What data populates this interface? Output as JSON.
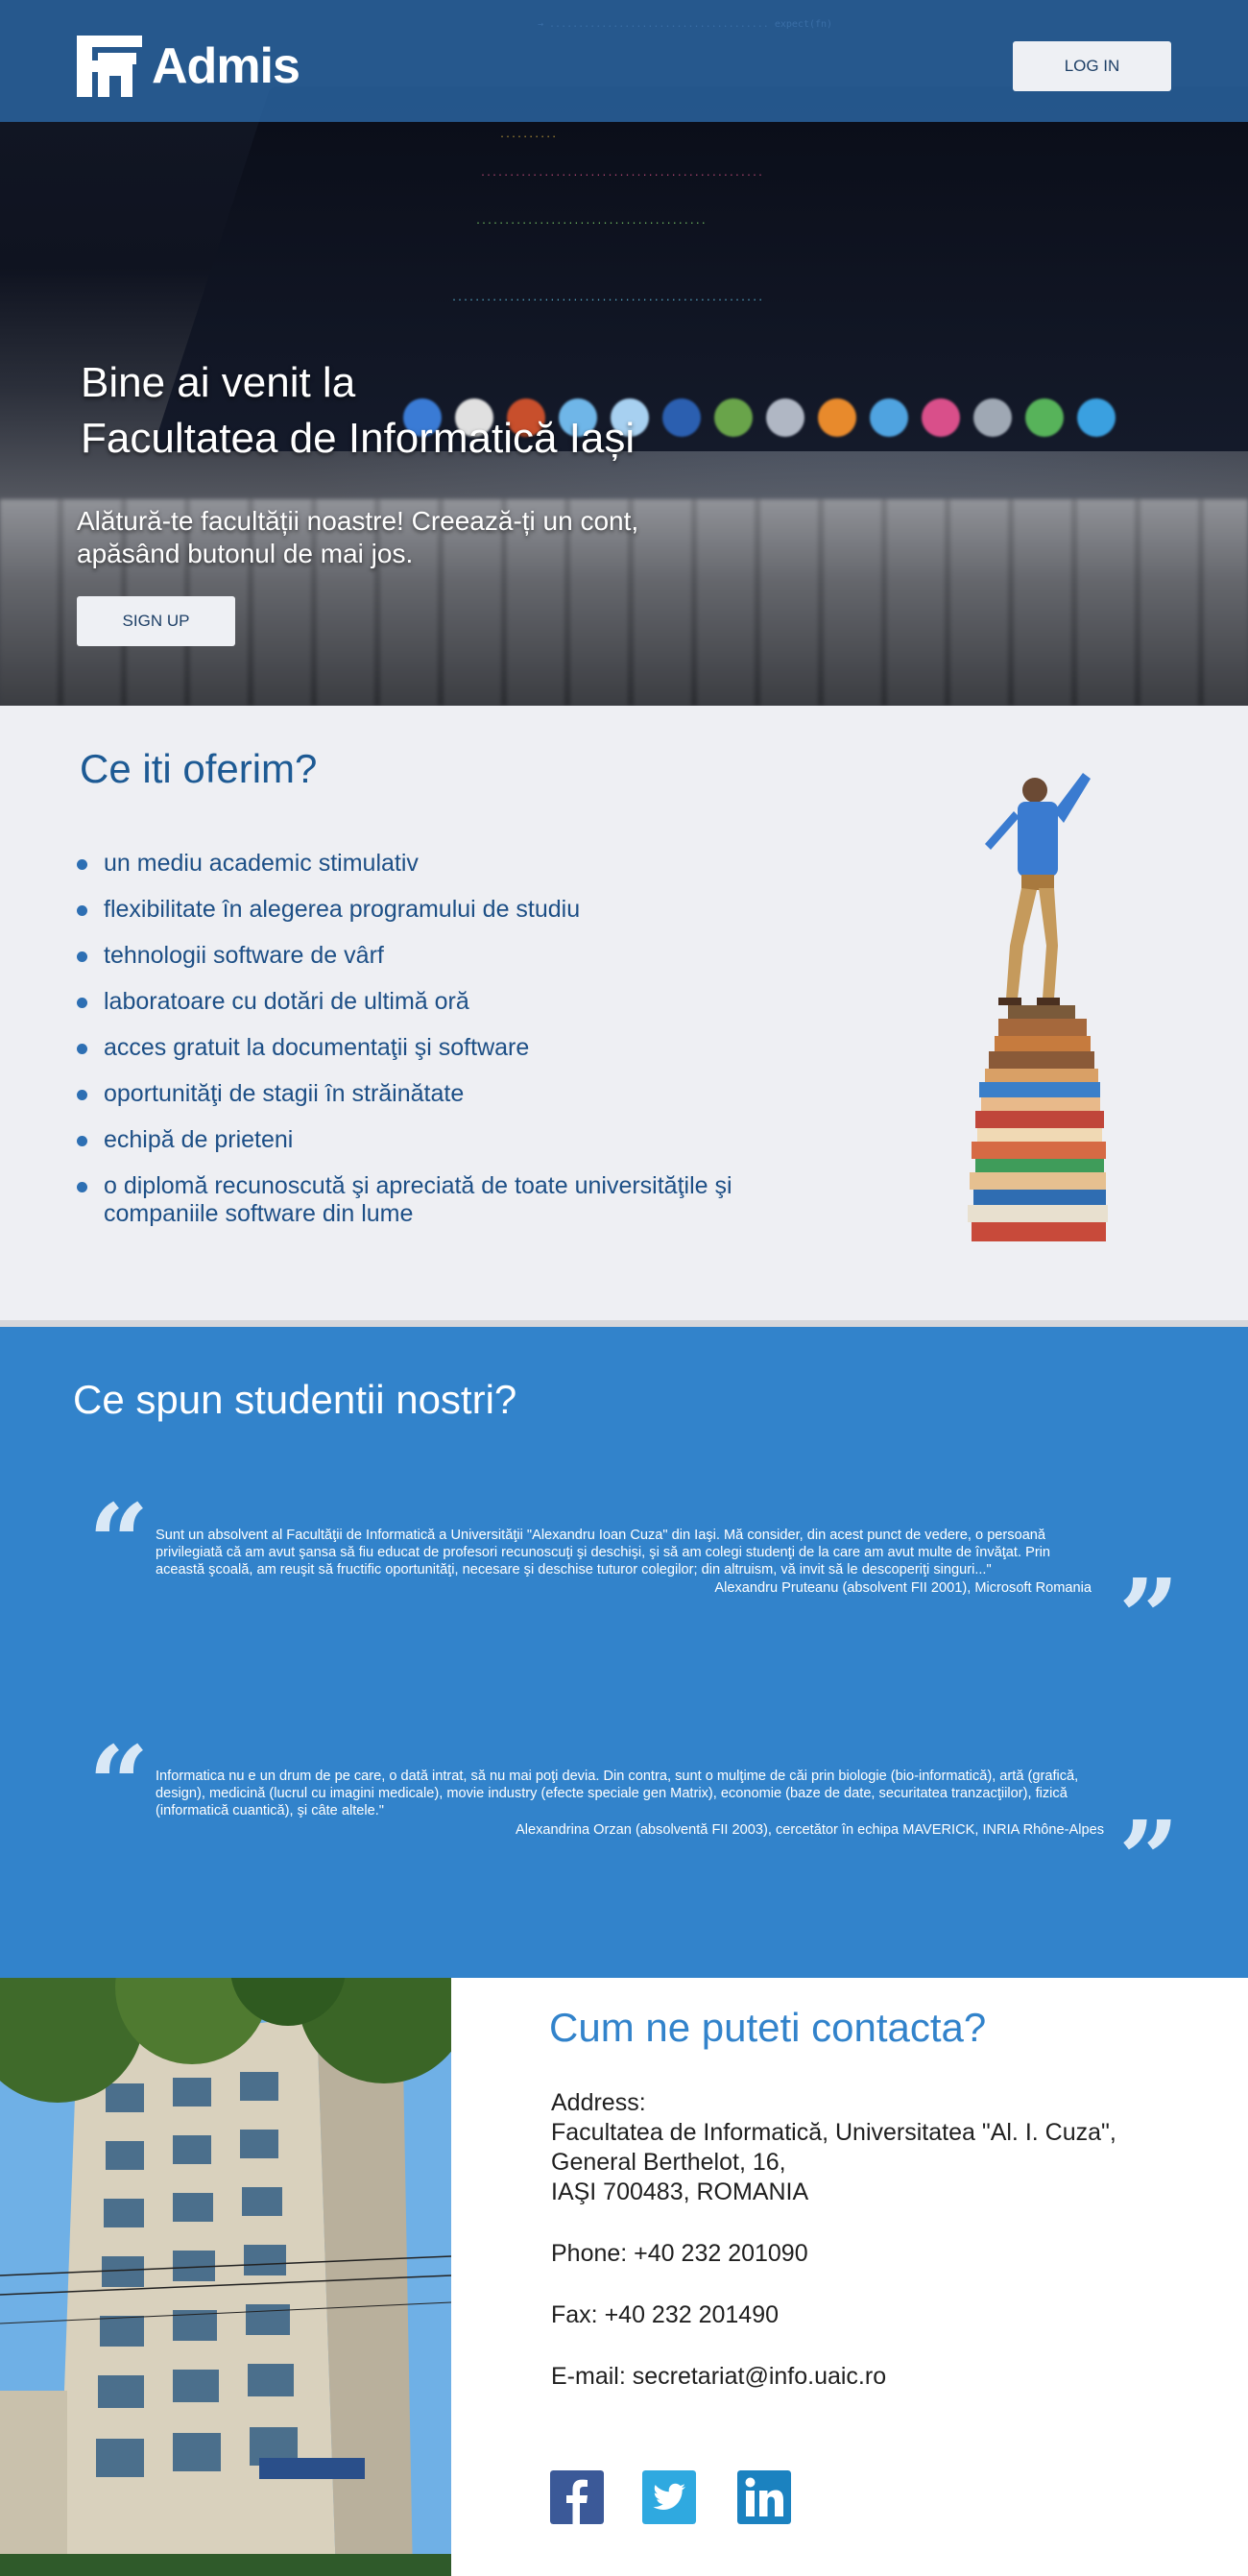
{
  "header": {
    "logo_text": "Admis",
    "login_label": "LOG IN"
  },
  "hero": {
    "title_line1": "Bine ai venit la",
    "title_line2": "Facultatea de Informatică Iași",
    "subtitle_line1": "Alătură-te facultății noastre! Creează-ți un cont,",
    "subtitle_line2": "apăsând butonul de mai jos.",
    "signup_label": "SIGN UP"
  },
  "offer": {
    "title": "Ce iti oferim?",
    "items": [
      "un mediu academic stimulativ",
      "flexibilitate în alegerea programului de studiu",
      "tehnologii software de vârf",
      "laboratoare cu dotări de ultimă oră",
      "acces gratuit la documentaţii şi software",
      "oportunităţi de stagii în străinătate",
      "echipă de prieteni",
      "o diplomă recunoscută şi apreciată de toate universităţile şi companiile software din lume"
    ]
  },
  "testimonials": {
    "title": "Ce spun studentii nostri?",
    "items": [
      {
        "text": "Sunt un absolvent al Facultăţii de Informatică a Universităţii \"Alexandru Ioan Cuza\" din Iaşi. Mă consider, din acest punct de vedere, o persoană privilegiată că am avut şansa să fiu educat de profesori recunoscuţi şi deschişi, şi să am colegi studenţi de la care am avut multe de învăţat. Prin această şcoală, am reuşit să fructific oportunităţi, necesare şi deschise tuturor colegilor; din altruism, vă invit să le descoperiţi singuri...\"",
        "author": "Alexandru Pruteanu (absolvent FII 2001), Microsoft Romania"
      },
      {
        "text": "Informatica nu e un drum de pe care, o dată intrat, să nu mai poţi devia. Din contra, sunt o mulţime de căi prin biologie (bio-informatică), artă (grafică, design), medicină (lucrul cu imagini medicale), movie industry (efecte speciale gen Matrix), economie (baze de date, securitatea tranzacţiilor), fizică (informatică cuantică), şi câte altele.\"",
        "author": "Alexandrina Orzan (absolventă FII 2003), cercetător în echipa MAVERICK, INRIA Rhône-Alpes"
      }
    ]
  },
  "contact": {
    "title": "Cum ne puteti contacta?",
    "address_label": "Address:",
    "address_line1": "Facultatea de Informatică, Universitatea \"Al. I. Cuza\",",
    "address_line2": "General Berthelot, 16,",
    "address_line3": "IAŞI 700483, ROMANIA",
    "phone": "Phone:  +40 232 201090",
    "fax": "Fax: +40 232 201490",
    "email": "E-mail: secretariat@info.uaic.ro",
    "social": [
      {
        "icon": "facebook-icon",
        "color": "#3b5998"
      },
      {
        "icon": "twitter-icon",
        "color": "#2fa9e0"
      },
      {
        "icon": "linkedin-icon",
        "color": "#1b82c0"
      }
    ]
  },
  "colors": {
    "header_blue": "#2b67a5",
    "testimonial_blue": "#3283cb",
    "heading_blue": "#1d5a94",
    "offer_bg": "#eeeff3"
  }
}
